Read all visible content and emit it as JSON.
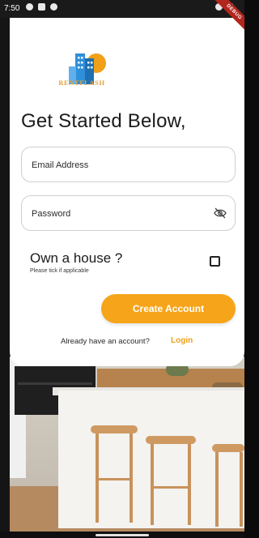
{
  "status_bar": {
    "time": "7:50",
    "left_icons": [
      "notification-icon",
      "sd-card-icon",
      "privacy-icon"
    ],
    "right_icons": [
      "wifi-icon",
      "battery-icon"
    ],
    "debug_badge": "DEBUG"
  },
  "logo": {
    "brand_text": "RENTFLASH",
    "colors": {
      "building": "#2f8fd8",
      "sun": "#f0a019",
      "text": "#e6a23c"
    }
  },
  "title": "Get Started Below,",
  "form": {
    "email": {
      "placeholder": "Email Address",
      "value": ""
    },
    "password": {
      "placeholder": "Password",
      "value": "",
      "toggle_icon": "eye-off-icon"
    },
    "own_house": {
      "label": "Own a house ?",
      "hint": "Please tick if applicable",
      "checked": false
    },
    "create_button": "Create Account",
    "login_prompt": "Already have an account?",
    "login_link": "Login"
  },
  "colors": {
    "accent": "#f6a419",
    "card": "#ffffff",
    "text": "#1b1b1b"
  }
}
